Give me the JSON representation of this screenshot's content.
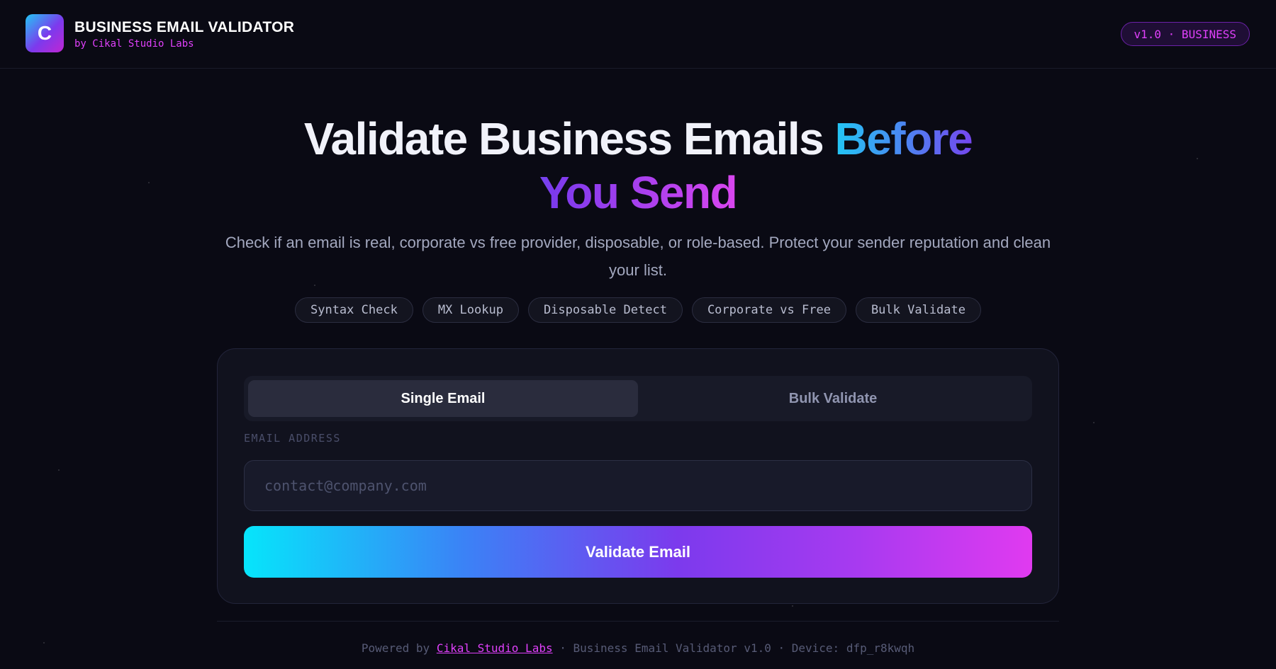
{
  "colors": {
    "background": "#0a0a14",
    "accent_magenta": "#e040fb",
    "accent_cyan": "#06e5fb",
    "accent_violet": "#7c3aed"
  },
  "header": {
    "logo_letter": "C",
    "logo_icon": "brand-logo-icon",
    "title": "BUSINESS EMAIL VALIDATOR",
    "subtitle": "by Cikal Studio Labs",
    "version_badge": "v1.0 · BUSINESS"
  },
  "hero": {
    "title_plain": "Validate Business Emails",
    "title_highlight": "Before You Send",
    "subtitle": "Check if an email is real, corporate vs free provider, disposable, or role-based. Protect your sender reputation and clean your list."
  },
  "features": [
    "Syntax Check",
    "MX Lookup",
    "Disposable Detect",
    "Corporate vs Free",
    "Bulk Validate"
  ],
  "validator": {
    "tabs": [
      {
        "label": "Single Email",
        "active": true
      },
      {
        "label": "Bulk Validate",
        "active": false
      }
    ],
    "email_label": "EMAIL ADDRESS",
    "email_value": "",
    "email_placeholder": "contact@company.com",
    "submit_label": "Validate Email"
  },
  "footer": {
    "prefix": "Powered by",
    "link_text": "Cikal Studio Labs",
    "suffix": "· Business Email Validator v1.0 · Device: dfp_r8kwqh"
  }
}
